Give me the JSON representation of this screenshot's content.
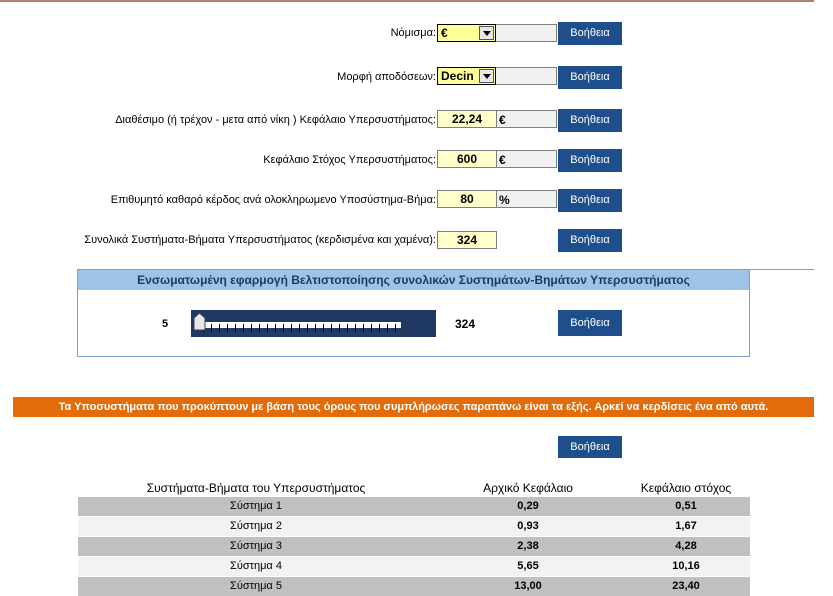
{
  "form": {
    "currency": {
      "label": "Νόμισμα:",
      "value": "€"
    },
    "odds_format": {
      "label": "Μορφή αποδόσεων:",
      "value": "Decin"
    },
    "available_capital": {
      "label": "Διαθέσιμο (ή τρέχον - μετα από νίκη ) Κεφάλαιο Υπερσυστήματος:",
      "value": "22,24",
      "unit": "€"
    },
    "target_capital": {
      "label": "Κεφάλαιο Στόχος Υπερσυστήματος:",
      "value": "600",
      "unit": "€"
    },
    "desired_profit": {
      "label": "Επιθυμητό καθαρό κέρδος ανά ολοκληρωμενο Υποσύστημα-Βήμα:",
      "value": "80",
      "unit": "%"
    },
    "total_systems": {
      "label": "Συνολικά Συστήματα-Βήματα Υπερσυστήματος (κερδισμένα και χαμένα):",
      "value": "324"
    }
  },
  "help_label": "Βοήθεια",
  "optimizer": {
    "title": "Ενσωματωμένη εφαρμογή Βελτιστοποίησης συνολικών Συστημάτων-Βημάτων Υπερσυστήματος",
    "min": "5",
    "max": "324",
    "level": 0
  },
  "banner": "Τα Υποσυστήματα που προκύπτουν με βάση τους όρους που συμπλήρωσες παραπάνω είναι τα εξής. Αρκεί να κερδίσεις ένα από αυτά.",
  "table": {
    "headers": [
      "Συστήματα-Βήματα του Υπερσυστήματος",
      "Αρχικό Κεφάλαιο",
      "Κεφάλαιο στόχος"
    ],
    "rows": [
      [
        "Σύστημα 1",
        "0,29",
        "0,51"
      ],
      [
        "Σύστημα 2",
        "0,93",
        "1,67"
      ],
      [
        "Σύστημα 3",
        "2,38",
        "4,28"
      ],
      [
        "Σύστημα 4",
        "5,65",
        "10,16"
      ],
      [
        "Σύστημα 5",
        "13,00",
        "23,40"
      ]
    ]
  },
  "colors": {
    "button": "#1f4e8c",
    "banner": "#e36c0a",
    "panel_header": "#9dc3e6",
    "row_even": "#c0c0c0",
    "row_odd": "#f2f2f2"
  }
}
